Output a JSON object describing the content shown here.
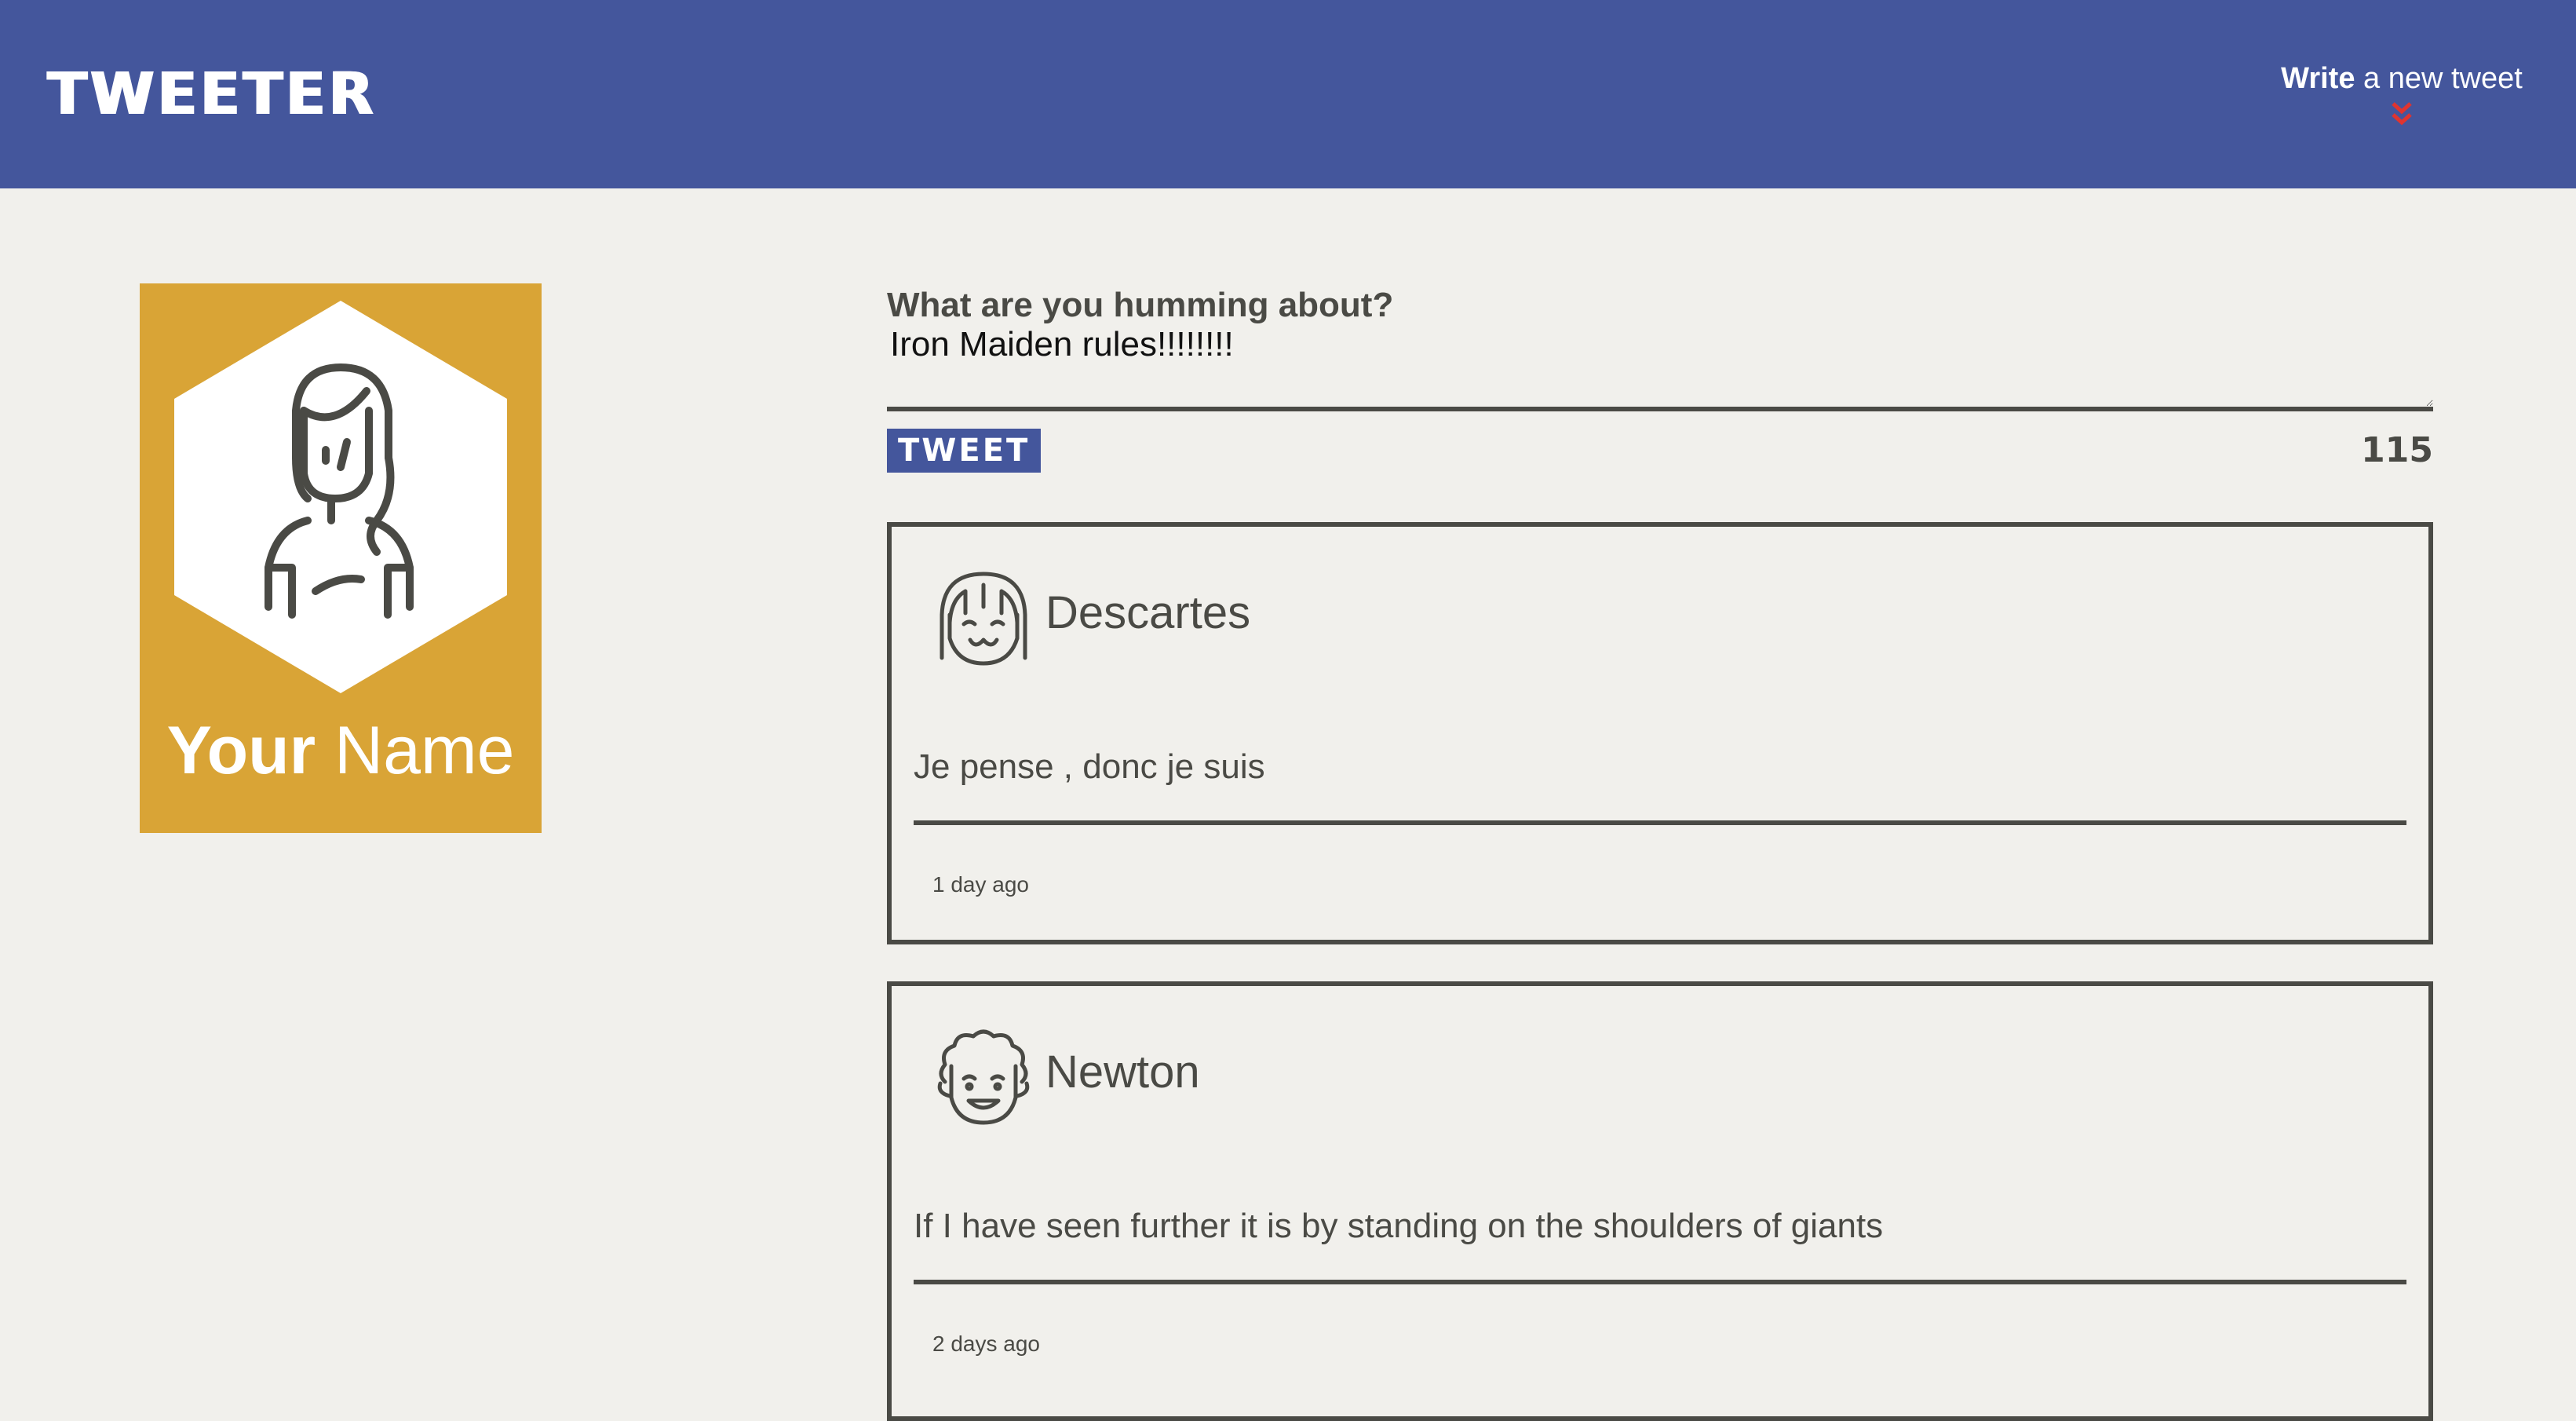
{
  "app": {
    "brand": "TWEETER"
  },
  "nav": {
    "compose_bold": "Write",
    "compose_rest": " a new tweet"
  },
  "profile": {
    "name_bold": "Your",
    "name_light": " Name"
  },
  "composer": {
    "label": "What are you humming about?",
    "text": "Iron Maiden rules!!!!!!!!",
    "button": "TWEET",
    "counter": "115"
  },
  "tweets": [
    {
      "author": "Descartes",
      "content": "Je pense , donc je suis",
      "time": "1 day ago",
      "avatar": "girl-face-icon"
    },
    {
      "author": "Newton",
      "content": "If I have seen further it is by standing on the shoulders of giants",
      "time": "2 days ago",
      "avatar": "curly-hair-face-icon"
    }
  ],
  "colors": {
    "navbar": "#44569c",
    "background": "#f1f0ec",
    "profile": "#d9a436",
    "ink": "#4a4a45",
    "chevron": "#e0342f"
  }
}
